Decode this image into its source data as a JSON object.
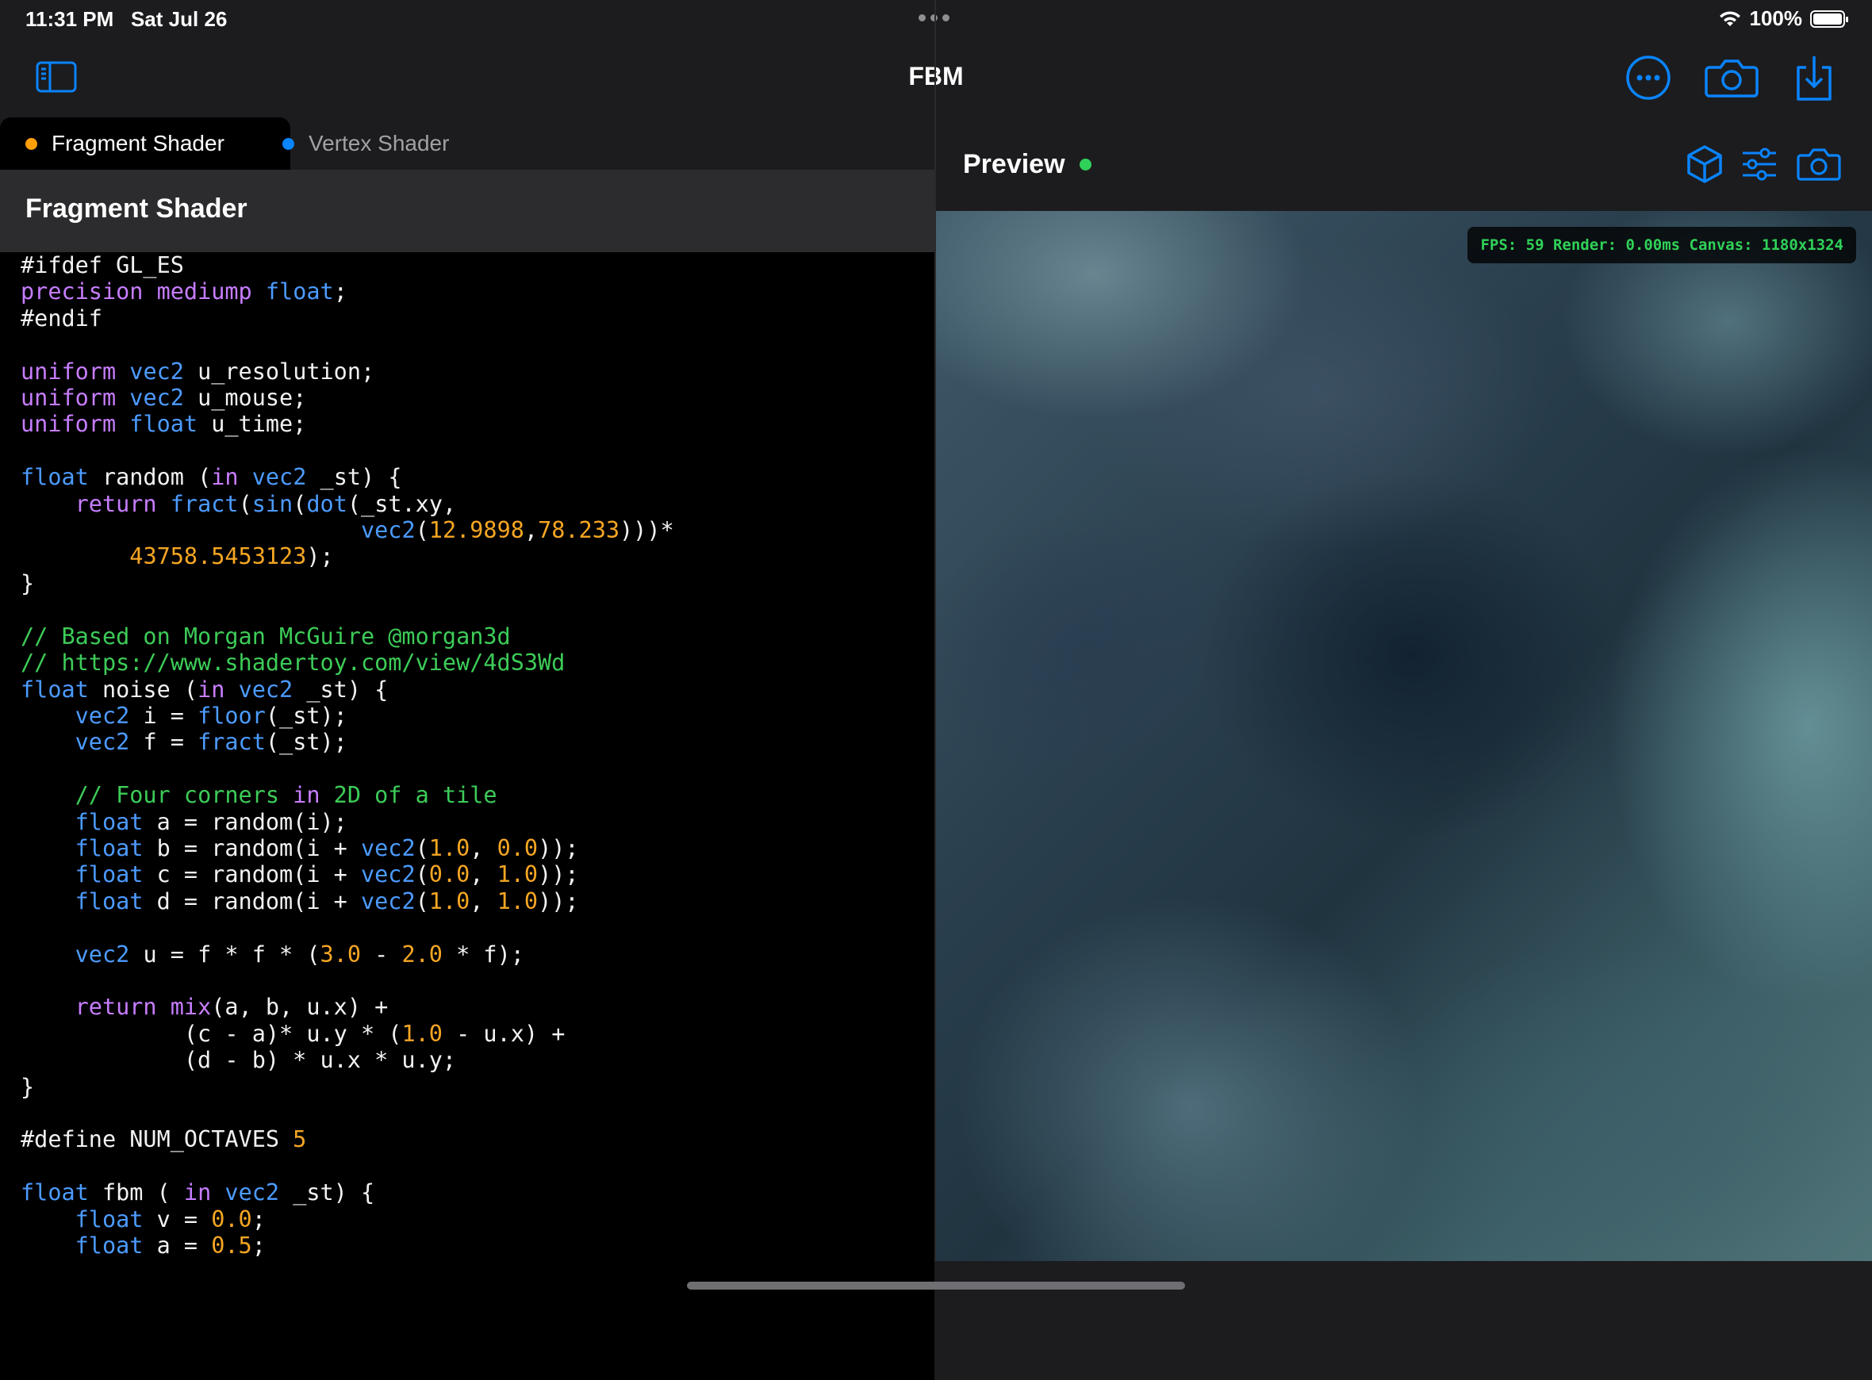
{
  "status_bar": {
    "time": "11:31 PM",
    "date": "Sat Jul 26",
    "battery": "100%",
    "battery_level": 1.0
  },
  "nav": {
    "title": "FBM"
  },
  "tabs": [
    {
      "label": "Fragment Shader",
      "color": "#ff9f0a",
      "active": true
    },
    {
      "label": "Vertex Shader",
      "color": "#0a84ff",
      "active": false
    }
  ],
  "section": {
    "title": "Fragment Shader"
  },
  "preview": {
    "title": "Preview",
    "status_color": "#30d158",
    "stats": "FPS: 59 Render: 0.00ms Canvas: 1180x1324"
  },
  "colors": {
    "accent": "#0a84ff",
    "keyword": "#c77dff",
    "type": "#4c9bff",
    "number": "#f5a623",
    "comment": "#3dcc58"
  },
  "icons": [
    "sidebar-toggle-icon",
    "more-ellipsis-icon",
    "camera-icon",
    "download-icon",
    "cube-icon",
    "sliders-icon",
    "camera-icon"
  ],
  "code_lines": [
    [
      [
        "p",
        "#ifdef GL_ES"
      ]
    ],
    [
      [
        "kw",
        "precision"
      ],
      [
        "p",
        " "
      ],
      [
        "kw",
        "mediump"
      ],
      [
        "p",
        " "
      ],
      [
        "ty",
        "float"
      ],
      [
        "p",
        ";"
      ]
    ],
    [
      [
        "p",
        "#endif"
      ]
    ],
    [
      [
        "p",
        ""
      ]
    ],
    [
      [
        "kw",
        "uniform"
      ],
      [
        "p",
        " "
      ],
      [
        "ty",
        "vec2"
      ],
      [
        "p",
        " u_resolution;"
      ]
    ],
    [
      [
        "kw",
        "uniform"
      ],
      [
        "p",
        " "
      ],
      [
        "ty",
        "vec2"
      ],
      [
        "p",
        " u_mouse;"
      ]
    ],
    [
      [
        "kw",
        "uniform"
      ],
      [
        "p",
        " "
      ],
      [
        "ty",
        "float"
      ],
      [
        "p",
        " u_time;"
      ]
    ],
    [
      [
        "p",
        ""
      ]
    ],
    [
      [
        "ty",
        "float"
      ],
      [
        "p",
        " random ("
      ],
      [
        "kw",
        "in"
      ],
      [
        "p",
        " "
      ],
      [
        "ty",
        "vec2"
      ],
      [
        "p",
        " _st) {"
      ]
    ],
    [
      [
        "p",
        "    "
      ],
      [
        "kw",
        "return"
      ],
      [
        "p",
        " "
      ],
      [
        "fn",
        "fract"
      ],
      [
        "p",
        "("
      ],
      [
        "fn",
        "sin"
      ],
      [
        "p",
        "("
      ],
      [
        "fn",
        "dot"
      ],
      [
        "p",
        "(_st.xy,"
      ]
    ],
    [
      [
        "p",
        "                         "
      ],
      [
        "ty",
        "vec2"
      ],
      [
        "p",
        "("
      ],
      [
        "num",
        "12.9898"
      ],
      [
        "p",
        ","
      ],
      [
        "num",
        "78.233"
      ],
      [
        "p",
        ")))*"
      ]
    ],
    [
      [
        "p",
        "        "
      ],
      [
        "num",
        "43758.5453123"
      ],
      [
        "p",
        ");"
      ]
    ],
    [
      [
        "p",
        "}"
      ]
    ],
    [
      [
        "p",
        ""
      ]
    ],
    [
      [
        "cm",
        "// Based on Morgan McGuire @morgan3d"
      ]
    ],
    [
      [
        "cm",
        "// https://www.shadertoy.com/view/4dS3Wd"
      ]
    ],
    [
      [
        "ty",
        "float"
      ],
      [
        "p",
        " noise ("
      ],
      [
        "kw",
        "in"
      ],
      [
        "p",
        " "
      ],
      [
        "ty",
        "vec2"
      ],
      [
        "p",
        " _st) {"
      ]
    ],
    [
      [
        "p",
        "    "
      ],
      [
        "ty",
        "vec2"
      ],
      [
        "p",
        " i = "
      ],
      [
        "fn",
        "floor"
      ],
      [
        "p",
        "(_st);"
      ]
    ],
    [
      [
        "p",
        "    "
      ],
      [
        "ty",
        "vec2"
      ],
      [
        "p",
        " f = "
      ],
      [
        "fn",
        "fract"
      ],
      [
        "p",
        "(_st);"
      ]
    ],
    [
      [
        "p",
        ""
      ]
    ],
    [
      [
        "p",
        "    "
      ],
      [
        "cm",
        "// Four corners "
      ],
      [
        "kw",
        "in"
      ],
      [
        "cm",
        " 2D of a tile"
      ]
    ],
    [
      [
        "p",
        "    "
      ],
      [
        "ty",
        "float"
      ],
      [
        "p",
        " a = random(i);"
      ]
    ],
    [
      [
        "p",
        "    "
      ],
      [
        "ty",
        "float"
      ],
      [
        "p",
        " b = random(i + "
      ],
      [
        "ty",
        "vec2"
      ],
      [
        "p",
        "("
      ],
      [
        "num",
        "1.0"
      ],
      [
        "p",
        ", "
      ],
      [
        "num",
        "0.0"
      ],
      [
        "p",
        "));"
      ]
    ],
    [
      [
        "p",
        "    "
      ],
      [
        "ty",
        "float"
      ],
      [
        "p",
        " c = random(i + "
      ],
      [
        "ty",
        "vec2"
      ],
      [
        "p",
        "("
      ],
      [
        "num",
        "0.0"
      ],
      [
        "p",
        ", "
      ],
      [
        "num",
        "1.0"
      ],
      [
        "p",
        "));"
      ]
    ],
    [
      [
        "p",
        "    "
      ],
      [
        "ty",
        "float"
      ],
      [
        "p",
        " d = random(i + "
      ],
      [
        "ty",
        "vec2"
      ],
      [
        "p",
        "("
      ],
      [
        "num",
        "1.0"
      ],
      [
        "p",
        ", "
      ],
      [
        "num",
        "1.0"
      ],
      [
        "p",
        "));"
      ]
    ],
    [
      [
        "p",
        ""
      ]
    ],
    [
      [
        "p",
        "    "
      ],
      [
        "ty",
        "vec2"
      ],
      [
        "p",
        " u = f * f * ("
      ],
      [
        "num",
        "3.0"
      ],
      [
        "p",
        " - "
      ],
      [
        "num",
        "2.0"
      ],
      [
        "p",
        " * f);"
      ]
    ],
    [
      [
        "p",
        ""
      ]
    ],
    [
      [
        "p",
        "    "
      ],
      [
        "kw",
        "return"
      ],
      [
        "p",
        " "
      ],
      [
        "kw",
        "mix"
      ],
      [
        "p",
        "(a, b, u.x) +"
      ]
    ],
    [
      [
        "p",
        "            (c - a)* u.y * ("
      ],
      [
        "num",
        "1.0"
      ],
      [
        "p",
        " - u.x) +"
      ]
    ],
    [
      [
        "p",
        "            (d - b) * u.x * u.y;"
      ]
    ],
    [
      [
        "p",
        "}"
      ]
    ],
    [
      [
        "p",
        ""
      ]
    ],
    [
      [
        "p",
        "#define NUM_OCTAVES "
      ],
      [
        "num",
        "5"
      ]
    ],
    [
      [
        "p",
        ""
      ]
    ],
    [
      [
        "ty",
        "float"
      ],
      [
        "p",
        " fbm ( "
      ],
      [
        "kw",
        "in"
      ],
      [
        "p",
        " "
      ],
      [
        "ty",
        "vec2"
      ],
      [
        "p",
        " _st) {"
      ]
    ],
    [
      [
        "p",
        "    "
      ],
      [
        "ty",
        "float"
      ],
      [
        "p",
        " v = "
      ],
      [
        "num",
        "0.0"
      ],
      [
        "p",
        ";"
      ]
    ],
    [
      [
        "p",
        "    "
      ],
      [
        "ty",
        "float"
      ],
      [
        "p",
        " a = "
      ],
      [
        "num",
        "0.5"
      ],
      [
        "p",
        ";"
      ]
    ]
  ]
}
